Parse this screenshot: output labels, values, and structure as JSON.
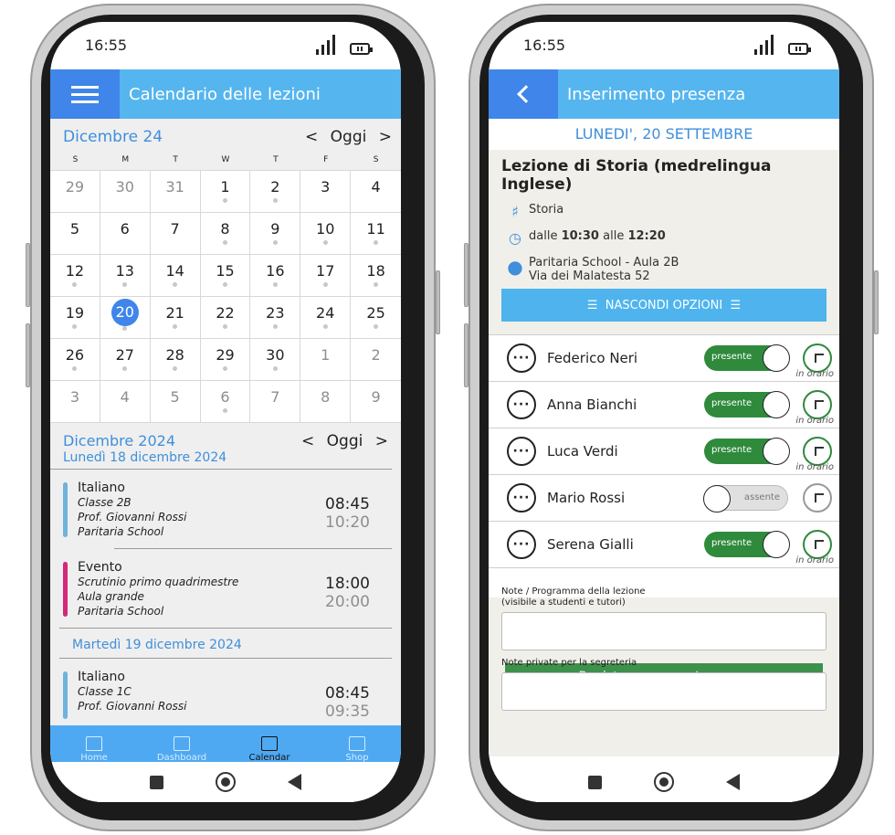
{
  "status": {
    "time_left": "16:55",
    "time_right": "16:55"
  },
  "calendar": {
    "header_title": "Calendario delle lezioni",
    "month_label": "Dicembre 24",
    "nav_prev": "<",
    "nav_today": "Oggi",
    "nav_next": ">",
    "weekdays": [
      "S",
      "M",
      "T",
      "W",
      "T",
      "F",
      "S"
    ],
    "weeks": [
      [
        {
          "d": "29",
          "muted": true,
          "dot": false
        },
        {
          "d": "30",
          "muted": true,
          "dot": false
        },
        {
          "d": "31",
          "muted": true,
          "dot": false
        },
        {
          "d": "1",
          "muted": false,
          "dot": true
        },
        {
          "d": "2",
          "muted": false,
          "dot": true
        },
        {
          "d": "3",
          "muted": false,
          "dot": false
        },
        {
          "d": "4",
          "muted": false,
          "dot": false
        }
      ],
      [
        {
          "d": "5",
          "muted": false,
          "dot": false
        },
        {
          "d": "6",
          "muted": false,
          "dot": false
        },
        {
          "d": "7",
          "muted": false,
          "dot": false
        },
        {
          "d": "8",
          "muted": false,
          "dot": true
        },
        {
          "d": "9",
          "muted": false,
          "dot": true
        },
        {
          "d": "10",
          "muted": false,
          "dot": true
        },
        {
          "d": "11",
          "muted": false,
          "dot": true
        }
      ],
      [
        {
          "d": "12",
          "muted": false,
          "dot": true
        },
        {
          "d": "13",
          "muted": false,
          "dot": true
        },
        {
          "d": "14",
          "muted": false,
          "dot": true
        },
        {
          "d": "15",
          "muted": false,
          "dot": true
        },
        {
          "d": "16",
          "muted": false,
          "dot": true
        },
        {
          "d": "17",
          "muted": false,
          "dot": true
        },
        {
          "d": "18",
          "muted": false,
          "dot": true
        }
      ],
      [
        {
          "d": "19",
          "muted": false,
          "dot": true
        },
        {
          "d": "20",
          "muted": false,
          "dot": true,
          "selected": true
        },
        {
          "d": "21",
          "muted": false,
          "dot": true
        },
        {
          "d": "22",
          "muted": false,
          "dot": true
        },
        {
          "d": "23",
          "muted": false,
          "dot": true
        },
        {
          "d": "24",
          "muted": false,
          "dot": true
        },
        {
          "d": "25",
          "muted": false,
          "dot": true
        }
      ],
      [
        {
          "d": "26",
          "muted": false,
          "dot": true
        },
        {
          "d": "27",
          "muted": false,
          "dot": true
        },
        {
          "d": "28",
          "muted": false,
          "dot": true
        },
        {
          "d": "29",
          "muted": false,
          "dot": true
        },
        {
          "d": "30",
          "muted": false,
          "dot": true
        },
        {
          "d": "1",
          "muted": true,
          "dot": false
        },
        {
          "d": "2",
          "muted": true,
          "dot": false
        }
      ],
      [
        {
          "d": "3",
          "muted": true,
          "dot": false
        },
        {
          "d": "4",
          "muted": true,
          "dot": false
        },
        {
          "d": "5",
          "muted": true,
          "dot": false
        },
        {
          "d": "6",
          "muted": true,
          "dot": true
        },
        {
          "d": "7",
          "muted": true,
          "dot": false
        },
        {
          "d": "8",
          "muted": true,
          "dot": false
        },
        {
          "d": "9",
          "muted": true,
          "dot": false
        }
      ]
    ],
    "agenda_month": "Dicembre 2024",
    "day1_label": "Lunedì 18 dicembre 2024",
    "day2_label": "Martedì 19 dicembre 2024",
    "events": [
      {
        "title": "Italiano",
        "l1": "Classe 2B",
        "l2": "Prof. Giovanni Rossi",
        "l3": "Paritaria School",
        "start": "08:45",
        "end": "10:20",
        "color": "#6fb3dc"
      },
      {
        "title": "Evento",
        "l1": "Scrutinio primo quadrimestre",
        "l2": "Aula grande",
        "l3": "Paritaria School",
        "start": "18:00",
        "end": "20:00",
        "color": "#d3287a"
      },
      {
        "title": "Italiano",
        "l1": "Classe 1C",
        "l2": "Prof. Giovanni Rossi",
        "l3": "",
        "start": "08:45",
        "end": "09:35",
        "color": "#6fb3dc"
      }
    ],
    "tabs": [
      {
        "label": "Home",
        "icon": "home-icon"
      },
      {
        "label": "Dashboard",
        "icon": "dashboard-icon"
      },
      {
        "label": "Calendar",
        "icon": "calendar-icon"
      },
      {
        "label": "Shop",
        "icon": "cart-icon"
      }
    ]
  },
  "attendance": {
    "header_title": "Inserimento presenza",
    "date": "LUNEDI', 20 SETTEMBRE",
    "lesson_title": "Lezione di Storia (medrelingua Inglese)",
    "subject": "Storia",
    "time_dalle": "dalle",
    "time_start": "10:30",
    "time_alle": "alle",
    "time_end": "12:20",
    "place1": "Paritaria School - Aula 2B",
    "place2": "Via dei Malatesta 52",
    "hide_options": "NASCONDI OPZIONI",
    "students": [
      {
        "name": "Federico Neri",
        "status": "presente",
        "present": true,
        "note": "in orario"
      },
      {
        "name": "Anna Bianchi",
        "status": "presente",
        "present": true,
        "note": "in orario"
      },
      {
        "name": "Luca Verdi",
        "status": "presente",
        "present": true,
        "note": "in orario"
      },
      {
        "name": "Mario Rossi",
        "status": "assente",
        "present": false,
        "note": ""
      },
      {
        "name": "Serena Gialli",
        "status": "presente",
        "present": true,
        "note": "in orario"
      }
    ],
    "notes_label1": "Note / Programma della lezione",
    "notes_label2": "(visibile a studenti e tutori)",
    "private_label": "Note private per la segreteria",
    "save_label": "Registra presenze/assenze"
  },
  "colors": {
    "primary_blue": "#55b5ef",
    "dark_blue": "#3f85ea",
    "green": "#2f8a3c",
    "magenta": "#d3287a"
  }
}
